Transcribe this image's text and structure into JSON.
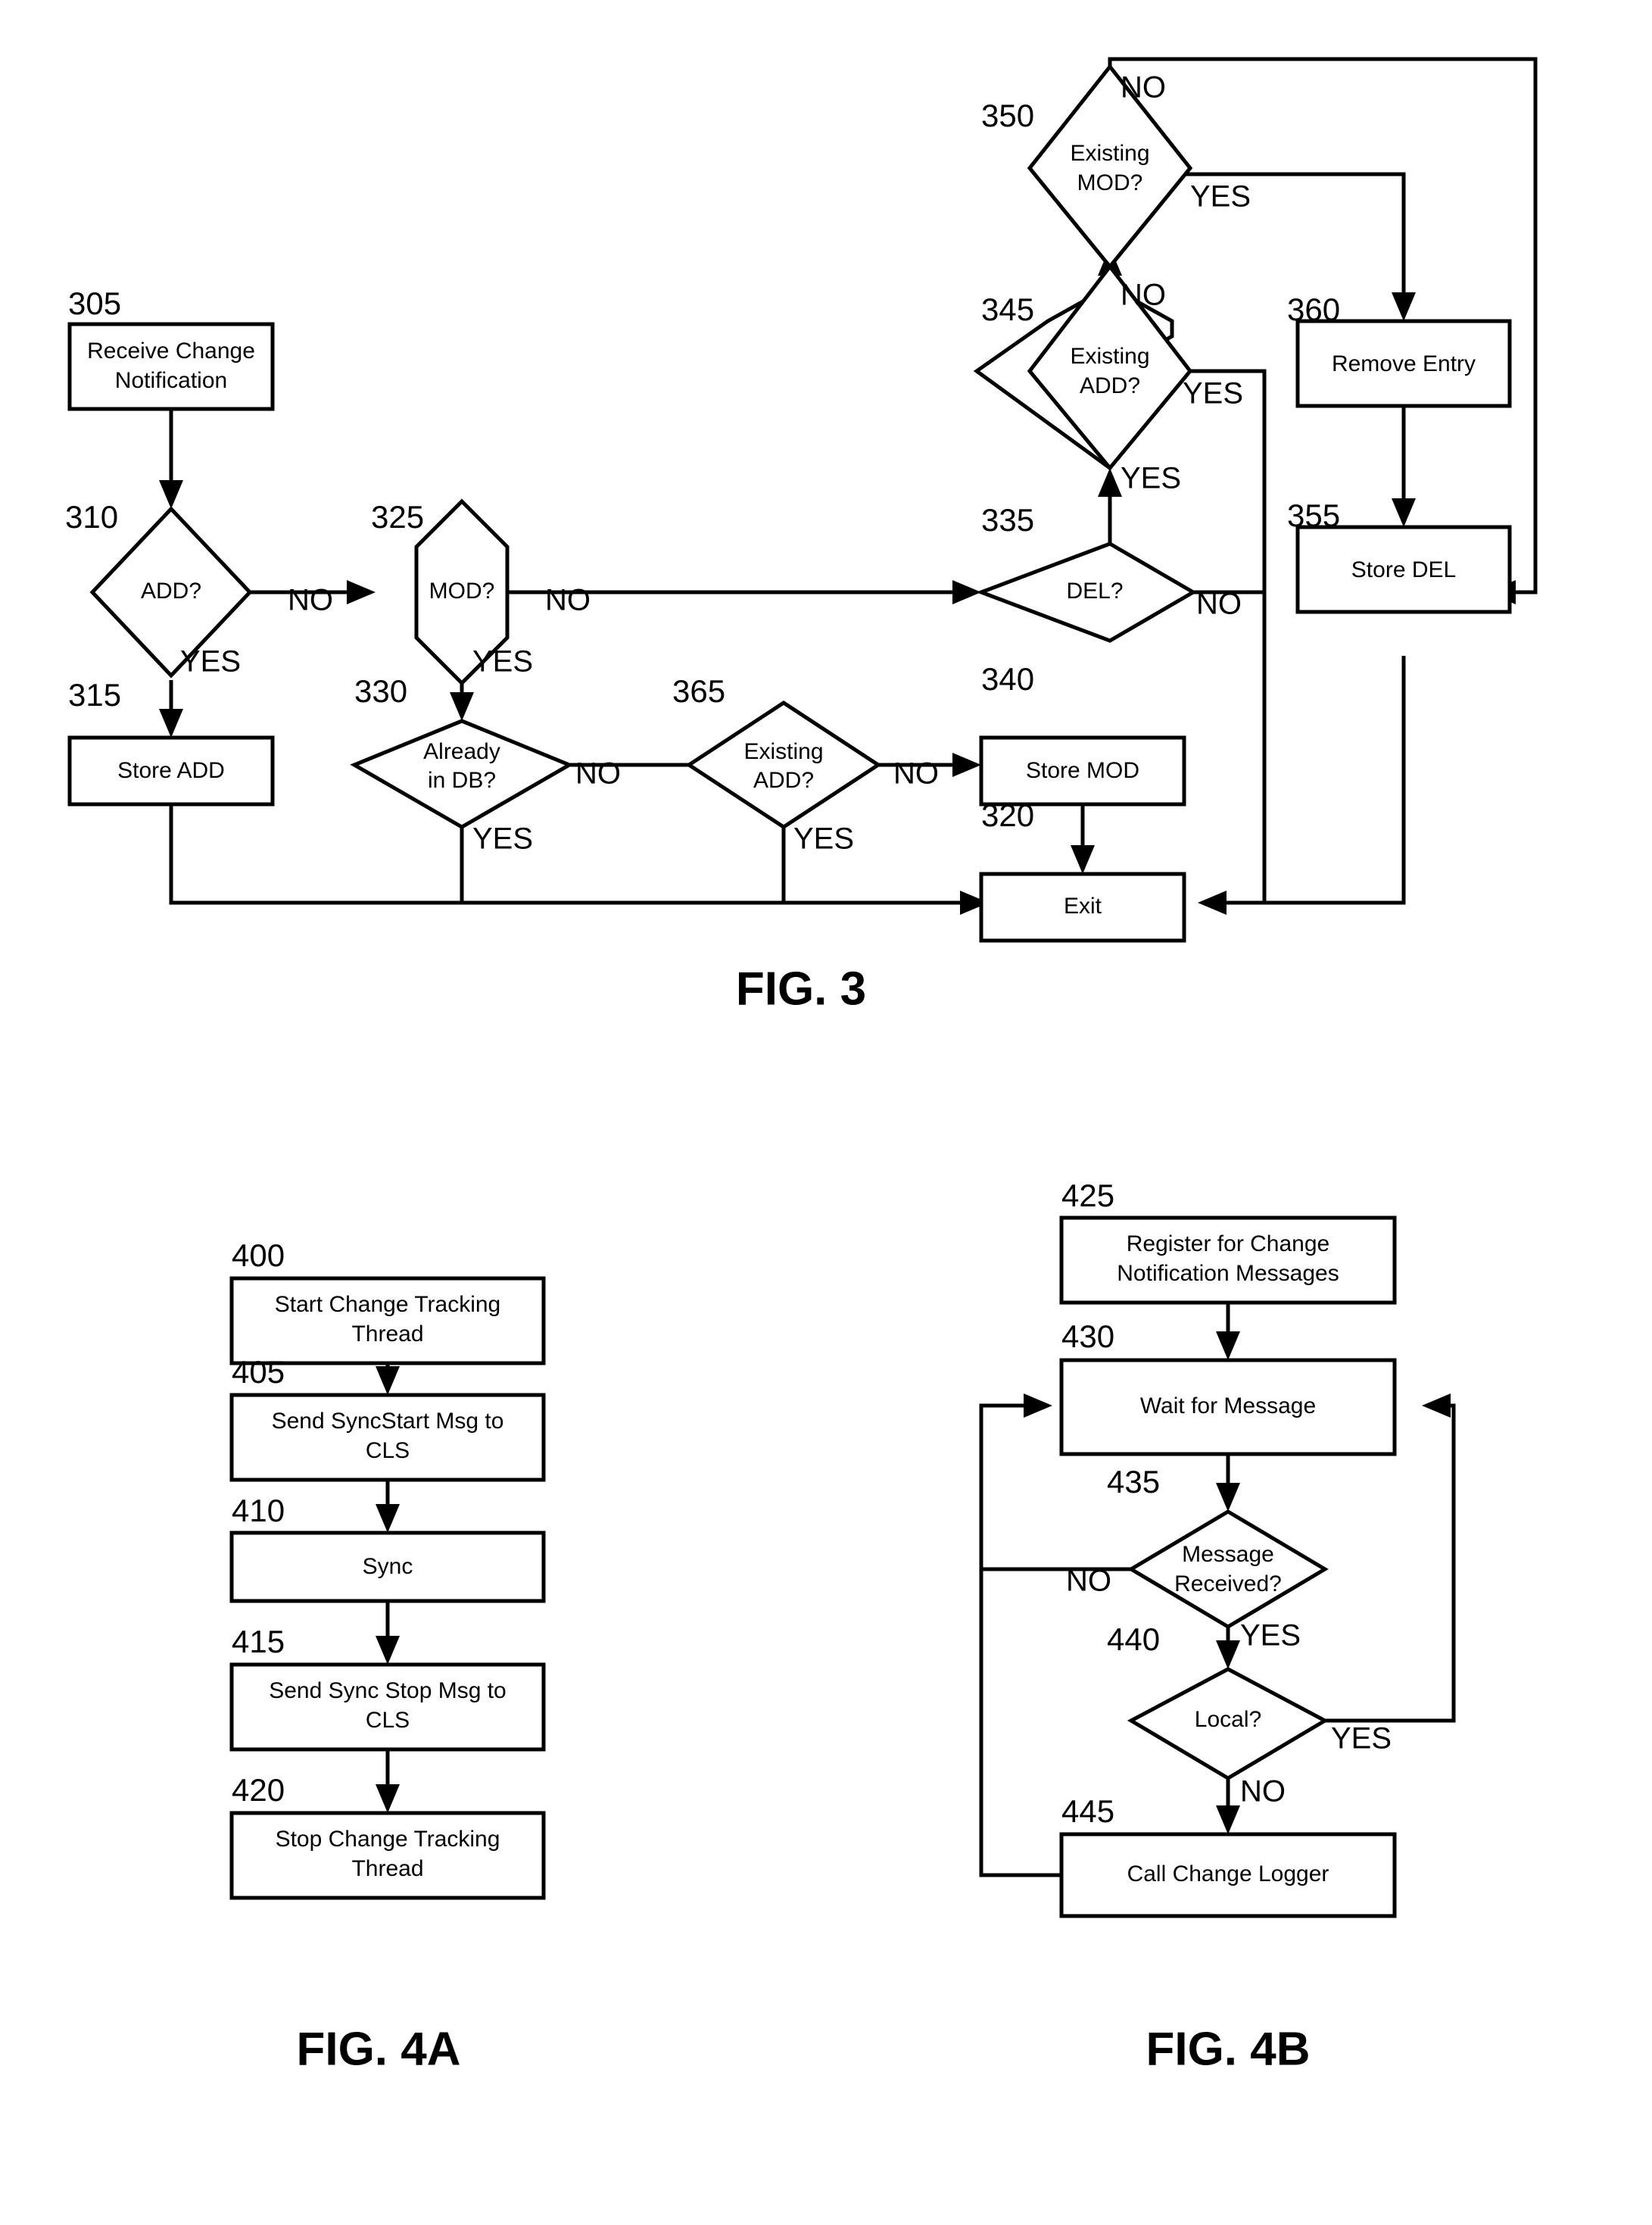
{
  "figures": [
    {
      "caption": "FIG. 3",
      "nodes": [
        {
          "ref": "305",
          "type": "process",
          "label_lines": [
            "Receive Change",
            "Notification"
          ]
        },
        {
          "ref": "310",
          "type": "decision",
          "label_lines": [
            "ADD?"
          ]
        },
        {
          "ref": "315",
          "type": "process",
          "label_lines": [
            "Store ADD"
          ]
        },
        {
          "ref": "320",
          "type": "process",
          "label_lines": [
            "Exit"
          ]
        },
        {
          "ref": "325",
          "type": "decision",
          "label_lines": [
            "MOD?"
          ]
        },
        {
          "ref": "330",
          "type": "decision",
          "label_lines": [
            "Already",
            "in DB?"
          ]
        },
        {
          "ref": "335",
          "type": "decision",
          "label_lines": [
            "DEL?"
          ]
        },
        {
          "ref": "340",
          "type": "process",
          "label_lines": [
            "Store MOD"
          ]
        },
        {
          "ref": "345",
          "type": "decision",
          "label_lines": [
            "Existing",
            "ADD?"
          ]
        },
        {
          "ref": "350",
          "type": "decision",
          "label_lines": [
            "Existing",
            "MOD?"
          ]
        },
        {
          "ref": "355",
          "type": "process",
          "label_lines": [
            "Store DEL"
          ]
        },
        {
          "ref": "360",
          "type": "process",
          "label_lines": [
            "Remove Entry"
          ]
        },
        {
          "ref": "365",
          "type": "decision",
          "label_lines": [
            "Existing",
            "ADD?"
          ]
        }
      ],
      "edge_labels": [
        "NO",
        "YES",
        "NO",
        "YES",
        "NO",
        "YES",
        "NO",
        "YES",
        "YES",
        "NO",
        "NO",
        "YES",
        "NO",
        "YES"
      ]
    },
    {
      "caption": "FIG. 4A",
      "nodes": [
        {
          "ref": "400",
          "type": "process",
          "label_lines": [
            "Start Change Tracking",
            "Thread"
          ]
        },
        {
          "ref": "405",
          "type": "process",
          "label_lines": [
            "Send SyncStart Msg to",
            "CLS"
          ]
        },
        {
          "ref": "410",
          "type": "process",
          "label_lines": [
            "Sync"
          ]
        },
        {
          "ref": "415",
          "type": "process",
          "label_lines": [
            "Send Sync Stop Msg to",
            "CLS"
          ]
        },
        {
          "ref": "420",
          "type": "process",
          "label_lines": [
            "Stop Change Tracking",
            "Thread"
          ]
        }
      ],
      "edge_labels": []
    },
    {
      "caption": "FIG. 4B",
      "nodes": [
        {
          "ref": "425",
          "type": "process",
          "label_lines": [
            "Register for Change",
            "Notification Messages"
          ]
        },
        {
          "ref": "430",
          "type": "process",
          "label_lines": [
            "Wait for Message"
          ]
        },
        {
          "ref": "435",
          "type": "decision",
          "label_lines": [
            "Message",
            "Received?"
          ]
        },
        {
          "ref": "440",
          "type": "decision",
          "label_lines": [
            "Local?"
          ]
        },
        {
          "ref": "445",
          "type": "process",
          "label_lines": [
            "Call Change Logger"
          ]
        }
      ],
      "edge_labels": [
        "NO",
        "YES",
        "YES",
        "NO"
      ]
    }
  ],
  "fig3": {
    "caption": "FIG. 3",
    "n305": {
      "ref": "305",
      "line1": "Receive Change",
      "line2": "Notification"
    },
    "n310": {
      "ref": "310",
      "line1": "ADD?"
    },
    "n315": {
      "ref": "315",
      "line1": "Store ADD"
    },
    "n320": {
      "ref": "320",
      "line1": "Exit"
    },
    "n325": {
      "ref": "325",
      "line1": "MOD?"
    },
    "n330": {
      "ref": "330",
      "line1": "Already",
      "line2": "in DB?"
    },
    "n335": {
      "ref": "335",
      "line1": "DEL?"
    },
    "n340": {
      "ref": "340",
      "line1": "Store MOD"
    },
    "n345": {
      "ref": "345",
      "line1": "Existing",
      "line2": "ADD?"
    },
    "n350": {
      "ref": "350",
      "line1": "Existing",
      "line2": "MOD?"
    },
    "n355": {
      "ref": "355",
      "line1": "Store DEL"
    },
    "n360": {
      "ref": "360",
      "line1": "Remove Entry"
    },
    "n365": {
      "ref": "365",
      "line1": "Existing",
      "line2": "ADD?"
    },
    "lbl_310_no": "NO",
    "lbl_310_yes": "YES",
    "lbl_325_no": "NO",
    "lbl_325_yes": "YES",
    "lbl_330_no": "NO",
    "lbl_330_yes": "YES",
    "lbl_365_no": "NO",
    "lbl_365_yes": "YES",
    "lbl_335_yes": "YES",
    "lbl_335_no": "NO",
    "lbl_345_no": "NO",
    "lbl_345_yes": "YES",
    "lbl_350_no": "NO",
    "lbl_350_yes": "YES"
  },
  "fig4a": {
    "caption": "FIG. 4A",
    "n400": {
      "ref": "400",
      "line1": "Start Change Tracking",
      "line2": "Thread"
    },
    "n405": {
      "ref": "405",
      "line1": "Send SyncStart Msg to",
      "line2": "CLS"
    },
    "n410": {
      "ref": "410",
      "line1": "Sync"
    },
    "n415": {
      "ref": "415",
      "line1": "Send Sync Stop Msg to",
      "line2": "CLS"
    },
    "n420": {
      "ref": "420",
      "line1": "Stop Change Tracking",
      "line2": "Thread"
    }
  },
  "fig4b": {
    "caption": "FIG. 4B",
    "n425": {
      "ref": "425",
      "line1": "Register for Change",
      "line2": "Notification Messages"
    },
    "n430": {
      "ref": "430",
      "line1": "Wait for Message"
    },
    "n435": {
      "ref": "435",
      "line1": "Message",
      "line2": "Received?"
    },
    "n440": {
      "ref": "440",
      "line1": "Local?"
    },
    "n445": {
      "ref": "445",
      "line1": "Call Change Logger"
    },
    "lbl_435_no": "NO",
    "lbl_435_yes": "YES",
    "lbl_440_yes": "YES",
    "lbl_440_no": "NO"
  },
  "colors": {
    "line": "#000000",
    "fill": "#ffffff",
    "background": "#ffffff"
  }
}
